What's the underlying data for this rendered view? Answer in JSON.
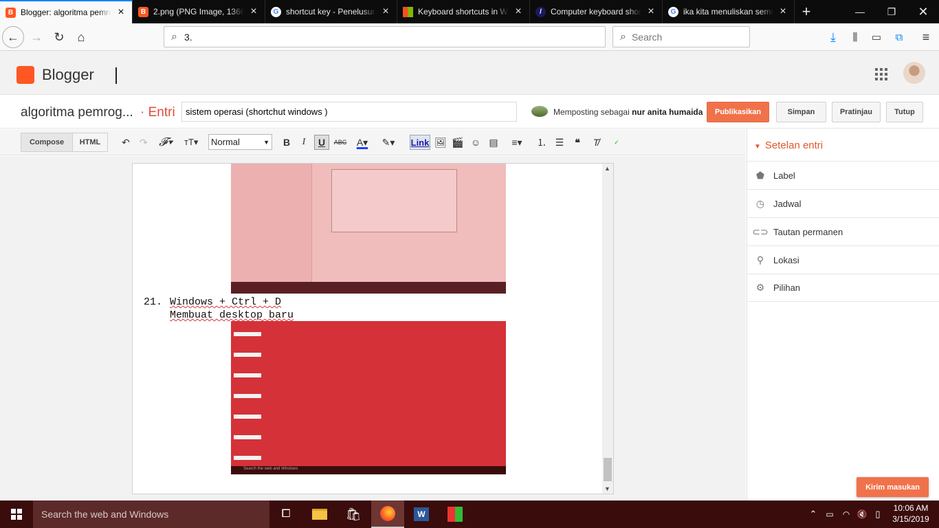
{
  "browser": {
    "tabs": [
      {
        "title": "Blogger: algoritma pemrog",
        "icon": "blogger-icon",
        "color": "#ff5722",
        "active": true
      },
      {
        "title": "2.png (PNG Image, 1366",
        "icon": "blogger-icon",
        "color": "#ff5722",
        "active": false
      },
      {
        "title": "shortcut key - Penelusura",
        "icon": "google-icon",
        "color": "#4285f4",
        "active": false
      },
      {
        "title": "Keyboard shortcuts in Wi",
        "icon": "microsoft-icon",
        "color": "#f25022",
        "active": false
      },
      {
        "title": "Computer keyboard shor",
        "icon": "site-icon",
        "color": "#1a1a5e",
        "active": false
      },
      {
        "title": "ika kita menuliskan semu",
        "icon": "google-icon",
        "color": "#4285f4",
        "active": false
      }
    ],
    "url": "3.",
    "search_placeholder": "Search"
  },
  "blogger": {
    "brand": "Blogger",
    "blog_title": "algoritma pemrog...",
    "entri": "· Entri",
    "post_title": "sistem operasi (shortchut windows )",
    "posting_as_prefix": "Memposting sebagai",
    "posting_as_user": "nur anita humaida",
    "buttons": {
      "publish": "Publikasikan",
      "save": "Simpan",
      "preview": "Pratinjau",
      "close": "Tutup"
    }
  },
  "toolbar": {
    "compose": "Compose",
    "html": "HTML",
    "format": "Normal",
    "link": "Link"
  },
  "content": {
    "item_number": "21.",
    "item_keys": "Windows + Ctrl + D",
    "item_desc": "Membuat desktop baru",
    "screenshot_search": "Search the web and Windows"
  },
  "settings": {
    "header": "Setelan entri",
    "items": [
      {
        "label": "Label",
        "icon": "label-icon"
      },
      {
        "label": "Jadwal",
        "icon": "clock-icon"
      },
      {
        "label": "Tautan permanen",
        "icon": "link-icon"
      },
      {
        "label": "Lokasi",
        "icon": "location-icon"
      },
      {
        "label": "Pilihan",
        "icon": "gear-icon"
      }
    ],
    "feedback": "Kirim masukan"
  },
  "taskbar": {
    "search_placeholder": "Search the web and Windows",
    "time": "10:06 AM",
    "date": "3/15/2019"
  }
}
